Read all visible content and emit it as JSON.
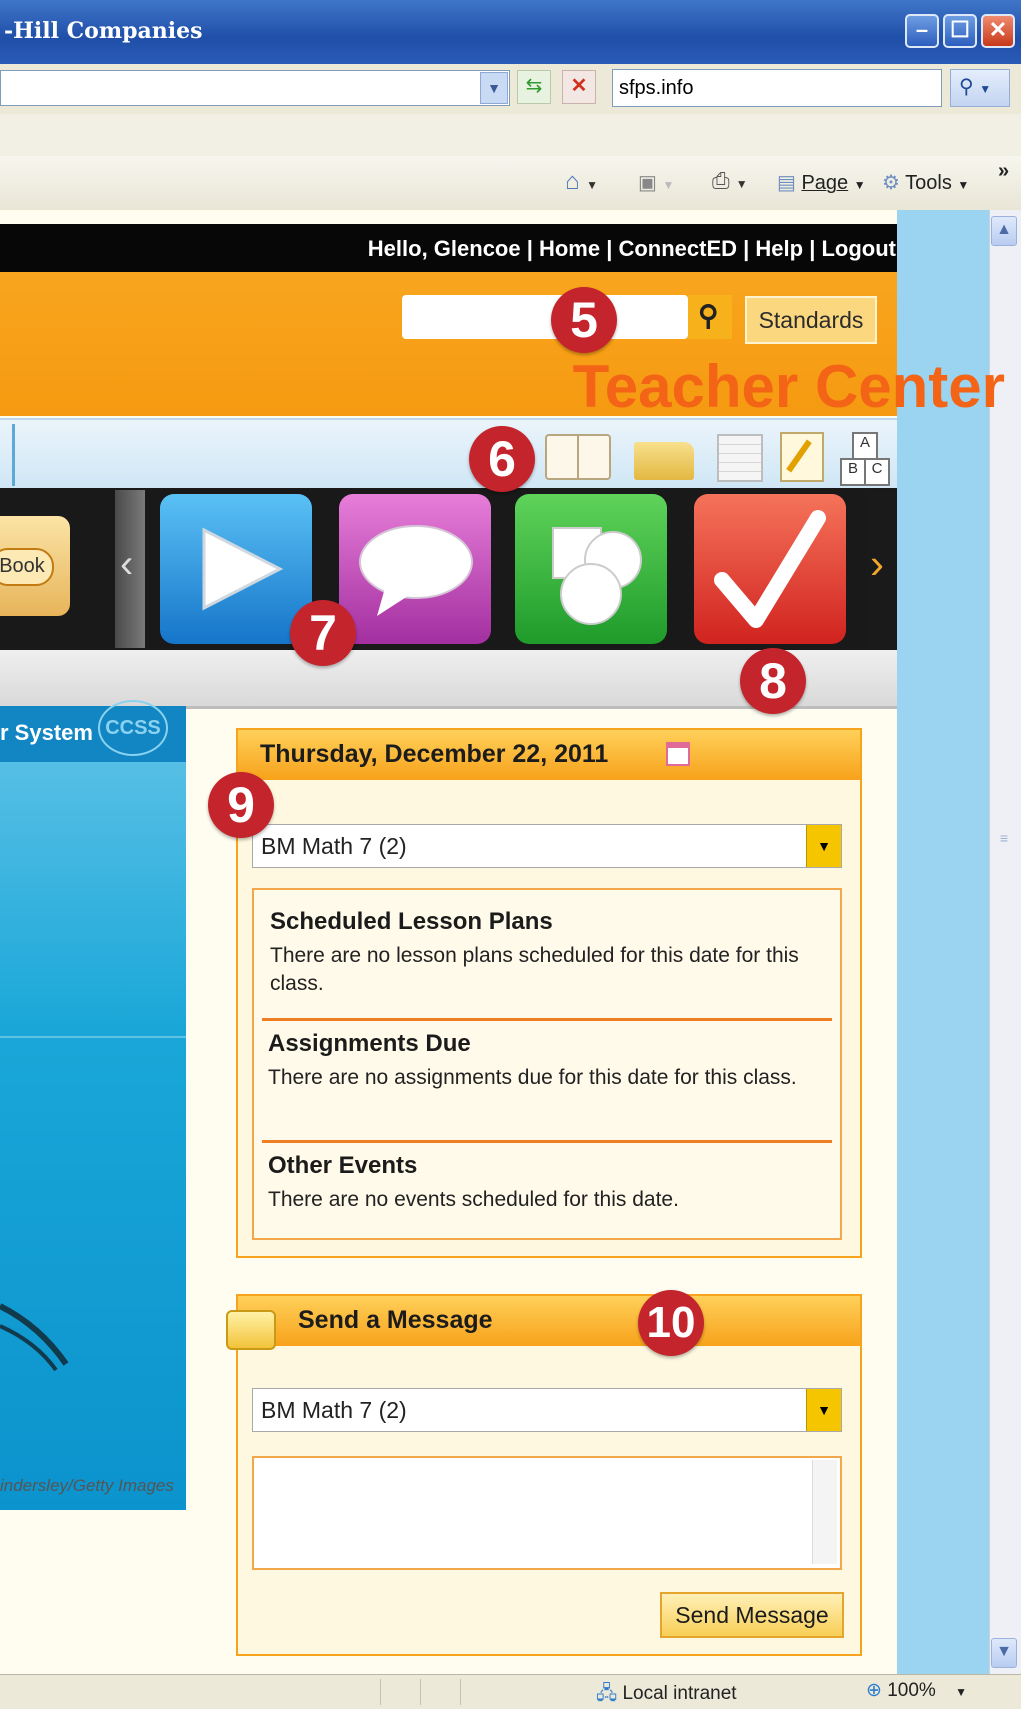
{
  "window": {
    "title": "-Hill Companies"
  },
  "address": {
    "search_text": "sfps.info"
  },
  "commandbar": {
    "page_label": "Page",
    "tools_label": "Tools",
    "chevrons": "»"
  },
  "site": {
    "toplinks": "Hello, Glencoe | Home | ConnectED | Help | Logout",
    "standards_label": "Standards",
    "brand": "Teacher Center",
    "ebook_label": "Book"
  },
  "leftpanel": {
    "header": "r System",
    "logo": "CCSS",
    "credit": "indersley/Getty Images"
  },
  "badges": {
    "b5": "5",
    "b6": "6",
    "b7": "7",
    "b8": "8",
    "b9": "9",
    "b10": "10"
  },
  "calendar": {
    "date": "Thursday, December 22, 2011",
    "class_select": "BM Math 7 (2)",
    "sections": [
      {
        "title": "Scheduled Lesson Plans",
        "body": "There are no lesson plans scheduled for this date for this class."
      },
      {
        "title": "Assignments Due",
        "body": "There are no assignments due for this date for this class."
      },
      {
        "title": "Other Events",
        "body": "There are no events scheduled for this date."
      }
    ]
  },
  "message": {
    "title": "Send a Message",
    "class_select": "BM Math 7 (2)",
    "body_value": "",
    "send_label": "Send Message"
  },
  "statusbar": {
    "zone": "Local intranet",
    "zoom": "100%"
  }
}
